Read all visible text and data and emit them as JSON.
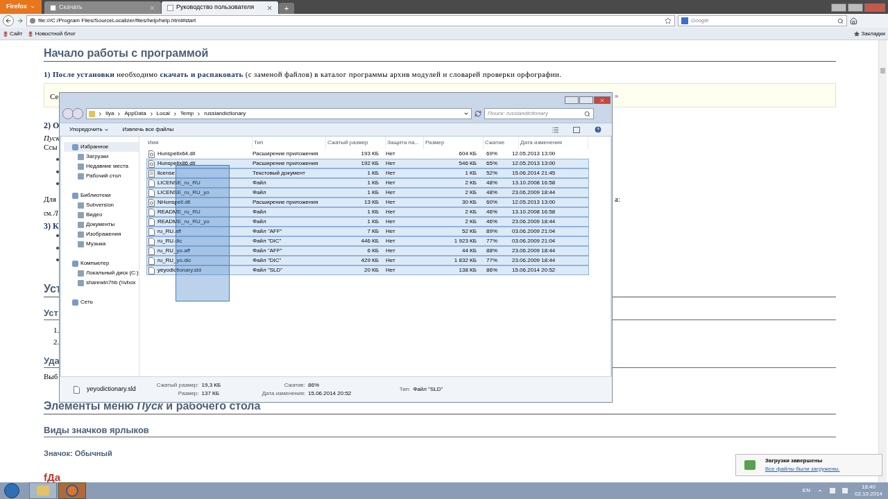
{
  "browser": {
    "menu_button": "Firefox",
    "tabs": [
      {
        "label": "Скачать",
        "selected": false
      },
      {
        "label": "Руководство пользователя",
        "selected": true
      }
    ],
    "new_tab": "+",
    "address": "file:///C:/Program Files/SourceLocalizer/files/help/help.html#start",
    "search_placeholder": "Google",
    "bookmarks": [
      "Сайт",
      "Новостной блог"
    ],
    "bookmarks_menu": "Закладки"
  },
  "page": [
    {
      "kind": "h1",
      "text": "Начало работы с программой"
    },
    {
      "kind": "rich",
      "text": "**1) После установки** необходимо **скачать и распаковать** (с заменой файлов) в каталог программы архив модулей и словарей проверки орфографии."
    },
    {
      "kind": "notice",
      "text": "Се",
      "right": "»"
    },
    {
      "kind": "bold",
      "text": "2) О"
    },
    {
      "kind": "italic",
      "text": "Пуск"
    },
    {
      "kind": "text",
      "text": "Ссы"
    },
    {
      "kind": "bullet"
    },
    {
      "kind": "bullet"
    },
    {
      "kind": "bullet"
    },
    {
      "kind": "text",
      "text": "Для",
      "right": "а:"
    },
    {
      "kind": "fragment",
      "text": "см. *Л*"
    },
    {
      "kind": "bold",
      "text": "3) К"
    },
    {
      "kind": "bullet"
    },
    {
      "kind": "bullet"
    },
    {
      "kind": "bullet"
    },
    {
      "kind": "h1",
      "text": "Уст"
    },
    {
      "kind": "h2",
      "text": "Уст"
    },
    {
      "kind": "number",
      "text": "1."
    },
    {
      "kind": "number",
      "text": "2."
    },
    {
      "kind": "h2",
      "text": "Уда"
    },
    {
      "kind": "text",
      "text": "Выб"
    },
    {
      "kind": "h1",
      "text": "Элементы меню *Пуск* и рабочего стола"
    },
    {
      "kind": "h2",
      "text": "Виды значков ярлыков"
    },
    {
      "kind": "label",
      "text": "Значок: Обычный"
    },
    {
      "kind": "logo",
      "text": "fДа"
    }
  ],
  "explorer": {
    "path": [
      "Ilya",
      "AppData",
      "Local",
      "Temp",
      "russiandictionary"
    ],
    "search_placeholder": "Поиск: russiandictionary",
    "toolbar": [
      "Упорядочить",
      "Извлечь все файлы"
    ],
    "nav": [
      {
        "label": "Избранное",
        "selected": true,
        "children": [
          {
            "label": "Загрузки",
            "selected": false
          },
          {
            "label": "Недавние места",
            "selected": false
          },
          {
            "label": "Рабочий стол",
            "selected": false
          }
        ]
      },
      {
        "label": "Библиотеки",
        "selected": false,
        "children": [
          {
            "label": "Subversion",
            "selected": false
          },
          {
            "label": "Видео",
            "selected": false
          },
          {
            "label": "Документы",
            "selected": false
          },
          {
            "label": "Изображения",
            "selected": false
          },
          {
            "label": "Музыка",
            "selected": false
          }
        ]
      },
      {
        "label": "Компьютер",
        "selected": false,
        "children": [
          {
            "label": "Локальный диск (C:)",
            "selected": false
          },
          {
            "label": "sharewin7hb (\\\\vbox",
            "selected": false
          }
        ]
      },
      {
        "label": "Сеть",
        "selected": false
      }
    ],
    "columns": [
      "Имя",
      "Тип",
      "Сжатый размер",
      "Защита па...",
      "Размер",
      "Сжатие",
      "Дата изменения"
    ],
    "files": [
      {
        "name": "Hunspellx64.dll",
        "kind": "dll",
        "type": "Расширение приложения",
        "csize": "193 КБ",
        "prot": "Нет",
        "size": "604 КБ",
        "ratio": "69%",
        "date": "12.05.2013 13:00",
        "selected": false
      },
      {
        "name": "Hunspellx86.dll",
        "kind": "dll",
        "type": "Расширение приложения",
        "csize": "192 КБ",
        "prot": "Нет",
        "size": "546 КБ",
        "ratio": "65%",
        "date": "12.05.2013 13:00",
        "selected": true
      },
      {
        "name": "license",
        "kind": "text",
        "type": "Текстовый документ",
        "csize": "1 КБ",
        "prot": "Нет",
        "size": "1 КБ",
        "ratio": "52%",
        "date": "15.06.2014 21:45",
        "selected": true
      },
      {
        "name": "LICENSE_ru_RU",
        "kind": "file",
        "type": "Файл",
        "csize": "1 КБ",
        "prot": "Нет",
        "size": "2 КБ",
        "ratio": "48%",
        "date": "13.10.2008 16:58",
        "selected": true
      },
      {
        "name": "LICENSE_ru_RU_yo",
        "kind": "file",
        "type": "Файл",
        "csize": "1 КБ",
        "prot": "Нет",
        "size": "2 КБ",
        "ratio": "48%",
        "date": "23.06.2009 18:44",
        "selected": true
      },
      {
        "name": "NHunspell.dll",
        "kind": "dll",
        "type": "Расширение приложения",
        "csize": "13 КБ",
        "prot": "Нет",
        "size": "30 КБ",
        "ratio": "60%",
        "date": "12.05.2013 13:00",
        "selected": true
      },
      {
        "name": "README_ru_RU",
        "kind": "file",
        "type": "Файл",
        "csize": "1 КБ",
        "prot": "Нет",
        "size": "2 КБ",
        "ratio": "46%",
        "date": "13.10.2008 16:58",
        "selected": true
      },
      {
        "name": "README_ru_RU_yo",
        "kind": "file",
        "type": "Файл",
        "csize": "1 КБ",
        "prot": "Нет",
        "size": "2 КБ",
        "ratio": "46%",
        "date": "23.06.2009 18:44",
        "selected": true
      },
      {
        "name": "ru_RU.aff",
        "kind": "file",
        "type": "Файл \"AFF\"",
        "csize": "7 КБ",
        "prot": "Нет",
        "size": "52 КБ",
        "ratio": "89%",
        "date": "03.06.2009 21:04",
        "selected": true
      },
      {
        "name": "ru_RU.dic",
        "kind": "file",
        "type": "Файл \"DIC\"",
        "csize": "446 КБ",
        "prot": "Нет",
        "size": "1 923 КБ",
        "ratio": "77%",
        "date": "03.06.2009 21:04",
        "selected": true
      },
      {
        "name": "ru_RU_yo.aff",
        "kind": "file",
        "type": "Файл \"AFF\"",
        "csize": "6 КБ",
        "prot": "Нет",
        "size": "44 КБ",
        "ratio": "88%",
        "date": "23.06.2009 18:44",
        "selected": true
      },
      {
        "name": "ru_RU_yo.dic",
        "kind": "file",
        "type": "Файл \"DIC\"",
        "csize": "429 КБ",
        "prot": "Нет",
        "size": "1 832 КБ",
        "ratio": "77%",
        "date": "23.06.2009 18:44",
        "selected": true
      },
      {
        "name": "yeyodictionary.sld",
        "kind": "file",
        "type": "Файл \"SLD\"",
        "csize": "20 КБ",
        "prot": "Нет",
        "size": "138 КБ",
        "ratio": "86%",
        "date": "15.06.2014 20:52",
        "selected": true
      }
    ],
    "details": {
      "name": "yeyodictionary.sld",
      "groups": [
        [
          {
            "label": "Сжатый размер:",
            "value": "19,3 КБ"
          },
          {
            "label": "Размер:",
            "value": "137 КБ"
          }
        ],
        [
          {
            "label": "Сжатие:",
            "value": "86%"
          },
          {
            "label": "Дата изменения:",
            "value": "15.06.2014 20:52"
          }
        ],
        [
          {
            "label": "Тип:",
            "value": "Файл \"SLD\""
          }
        ]
      ]
    }
  },
  "notification": {
    "title": "Загрузки завершены",
    "link": "Все файлы были загружены."
  },
  "taskbar": {
    "apps": [
      {
        "kind": "explorer",
        "selected": false
      },
      {
        "kind": "firefox",
        "selected": true
      }
    ],
    "language": "EN",
    "time": "18:40",
    "date": "02.10.2014"
  }
}
